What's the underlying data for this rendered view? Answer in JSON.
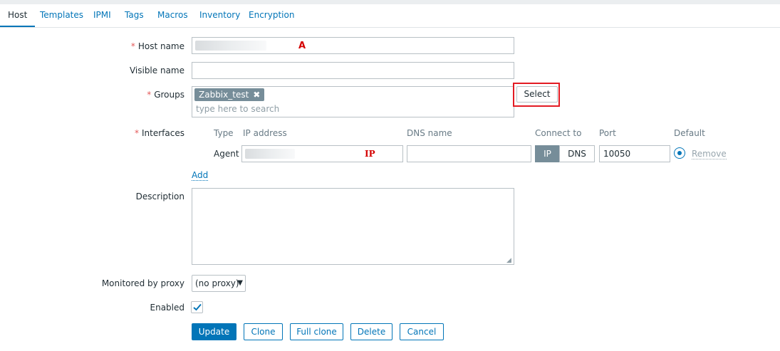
{
  "tabs": [
    "Host",
    "Templates",
    "IPMI",
    "Tags",
    "Macros",
    "Inventory",
    "Encryption"
  ],
  "form": {
    "host_name": {
      "label": "Host name",
      "required_mark": "*",
      "annotation": "A"
    },
    "visible_name": {
      "label": "Visible name",
      "value": ""
    },
    "groups": {
      "label": "Groups",
      "required_mark": "*",
      "chip": "Zabbix_test",
      "chip_remove": "✖",
      "placeholder": "type here to search",
      "select_label": "Select"
    },
    "interfaces": {
      "label": "Interfaces",
      "required_mark": "*",
      "columns": {
        "type": "Type",
        "ip": "IP address",
        "dns": "DNS name",
        "connect": "Connect to",
        "port": "Port",
        "default": "Default"
      },
      "row": {
        "type": "Agent",
        "ip_annotation": "IP",
        "dns": "",
        "connect_ip": "IP",
        "connect_dns": "DNS",
        "port": "10050",
        "remove": "Remove"
      },
      "add": "Add"
    },
    "description": {
      "label": "Description",
      "value": ""
    },
    "proxy": {
      "label": "Monitored by proxy",
      "value": "(no proxy)"
    },
    "enabled": {
      "label": "Enabled",
      "checked": true
    }
  },
  "actions": {
    "update": "Update",
    "clone": "Clone",
    "full_clone": "Full clone",
    "delete": "Delete",
    "cancel": "Cancel"
  },
  "colors": {
    "accent": "#0275b8",
    "required": "#e45959",
    "highlight": "#e31b23"
  }
}
